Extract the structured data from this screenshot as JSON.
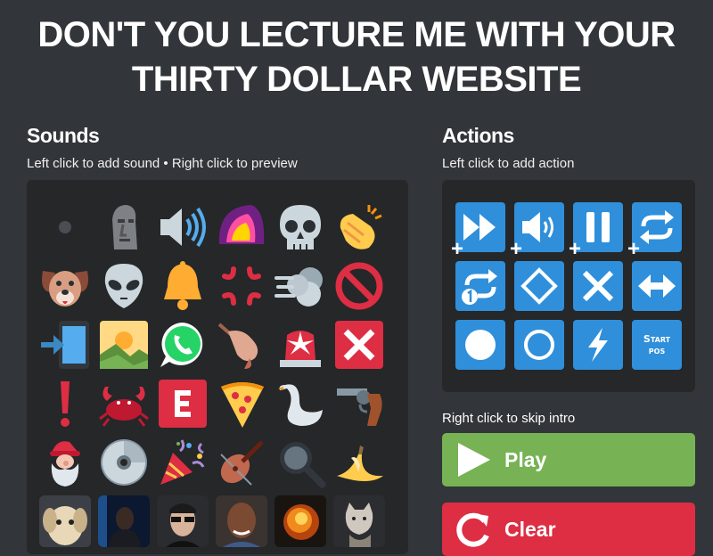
{
  "header": {
    "title_line1": "DON'T YOU LECTURE ME WITH YOUR",
    "title_line2": "THIRTY DOLLAR WEBSITE"
  },
  "sounds": {
    "heading": "Sounds",
    "hint": "Left click to add sound • Right click to preview",
    "items": [
      "silence-dot-icon",
      "moai-icon",
      "speaker-loud-icon",
      "taco-bell-icon",
      "skull-icon",
      "clapping-hands-icon",
      "dog-face-icon",
      "alien-icon",
      "bell-icon",
      "anger-symbol-icon",
      "dashing-away-icon",
      "prohibited-icon",
      "phone-arrow-icon",
      "sunrise-mountains-icon",
      "whatsapp-icon",
      "finger-pointing-icon",
      "siren-light-icon",
      "cross-mark-icon",
      "exclamation-icon",
      "crab-icon",
      "letter-e-icon",
      "pizza-icon",
      "swan-icon",
      "revolver-icon",
      "gnome-icon",
      "cd-disc-icon",
      "party-popper-icon",
      "violin-icon",
      "magnifying-glass-icon",
      "banana-icon",
      "puppy-photo-icon",
      "dark-figure-photo-icon",
      "man-sunglasses-photo-icon",
      "bald-man-photo-icon",
      "explosion-photo-icon",
      "cat-photo-icon"
    ]
  },
  "actions": {
    "heading": "Actions",
    "hint": "Left click to add action",
    "items": [
      "speed-fast-forward-icon",
      "volume-icon",
      "pause-icon",
      "loop-icon",
      "loop-once-icon",
      "diamond-target-icon",
      "cut-x-icon",
      "stretch-arrows-icon",
      "filled-circle-icon",
      "ring-circle-icon",
      "lightning-icon",
      "start-pos-icon"
    ],
    "plus": "+",
    "start_pos_line1": "Start",
    "start_pos_line2": "pos"
  },
  "controls": {
    "skip_hint": "Right click to skip intro",
    "play_label": "Play",
    "clear_label": "Clear"
  },
  "colors": {
    "background": "#323539",
    "panel": "#252729",
    "action_blue": "#2f8fdb",
    "play_green": "#77b255",
    "clear_red": "#dd2e44"
  }
}
